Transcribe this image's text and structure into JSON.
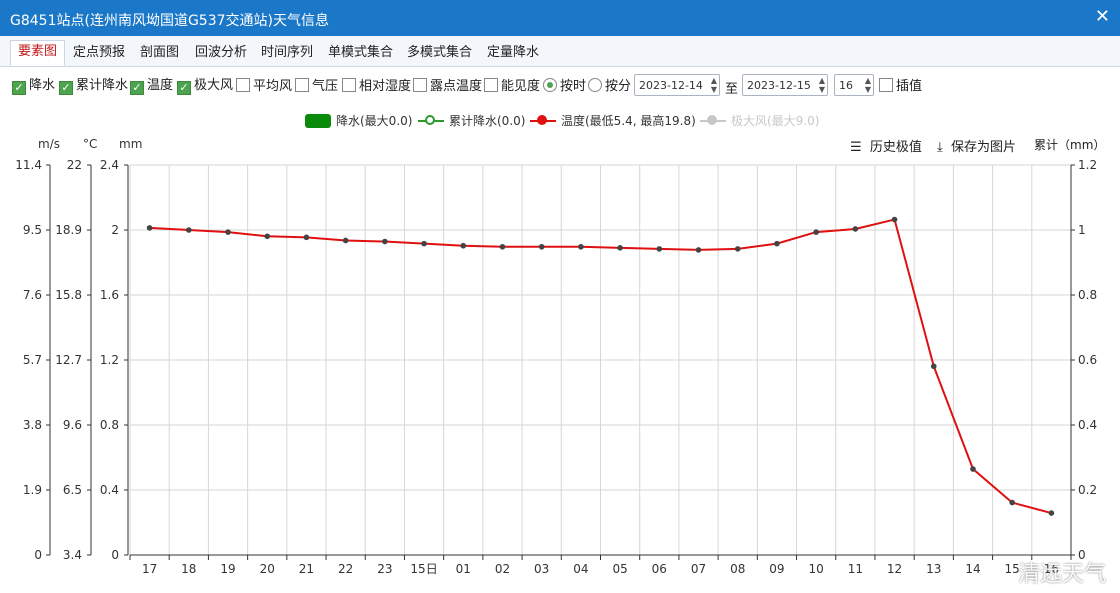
{
  "window": {
    "title": "G8451站点(连州南风坳国道G537交通站)天气信息"
  },
  "tabs": [
    "要素图",
    "定点预报",
    "剖面图",
    "回波分析",
    "时间序列",
    "单模式集合",
    "多模式集合",
    "定量降水"
  ],
  "active_tab": "要素图",
  "toolbar": {
    "checkboxes": [
      {
        "label": "降水",
        "checked": true
      },
      {
        "label": "累计降水",
        "checked": true
      },
      {
        "label": "温度",
        "checked": true
      },
      {
        "label": "极大风",
        "checked": true
      },
      {
        "label": "平均风",
        "checked": false
      },
      {
        "label": "气压",
        "checked": false
      },
      {
        "label": "相对湿度",
        "checked": false
      },
      {
        "label": "露点温度",
        "checked": false
      },
      {
        "label": "能见度",
        "checked": false
      }
    ],
    "radio_hourly": "按时",
    "radio_daily": "按分",
    "radio_selected": "按时",
    "start_date": "2023-12-14",
    "to_label": "至",
    "end_date": "2023-12-15",
    "hour_value": "16",
    "interp_label": "插值",
    "interp_checked": false
  },
  "legend": {
    "precip": "降水(最大0.0)",
    "cum_precip": "累计降水(0.0)",
    "temp": "温度(最低5.4, 最高19.8)",
    "wind": "极大风(最大9.0)"
  },
  "chart_tools": {
    "history": "历史极值",
    "save": "保存为图片",
    "right_unit": "累计（mm）"
  },
  "colors": {
    "title_bar": "#1b78c8",
    "active_tab": "#c31a1a",
    "precip": "#0a8a0a",
    "cum_precip": "#2e9a2e",
    "temp": "#e01010",
    "wind_legend": "#c8c8c8"
  },
  "watermark": "清远天气",
  "chart_data": {
    "type": "line",
    "x": [
      "17",
      "18",
      "19",
      "20",
      "21",
      "22",
      "23",
      "15日",
      "01",
      "02",
      "03",
      "04",
      "05",
      "06",
      "07",
      "08",
      "09",
      "10",
      "11",
      "12",
      "13",
      "14",
      "15",
      "16"
    ],
    "series": [
      {
        "name": "温度(最低5.4, 最高19.8)",
        "axis": "temp",
        "values": [
          19.0,
          18.9,
          18.8,
          18.6,
          18.55,
          18.4,
          18.35,
          18.25,
          18.15,
          18.1,
          18.1,
          18.1,
          18.05,
          18.0,
          17.95,
          18.0,
          18.25,
          18.8,
          18.95,
          19.4,
          12.4,
          7.5,
          5.9,
          5.4
        ]
      }
    ],
    "axes": {
      "wind": {
        "unit": "m/s",
        "ticks": [
          "0",
          "1.9",
          "3.8",
          "5.7",
          "7.6",
          "9.5",
          "11.4"
        ]
      },
      "temp": {
        "unit": "°C",
        "ticks": [
          "3.4",
          "6.5",
          "9.6",
          "12.7",
          "15.8",
          "18.9",
          "22"
        ],
        "range": [
          3.4,
          22
        ]
      },
      "precip": {
        "unit": "mm",
        "ticks": [
          "0",
          "0.4",
          "0.8",
          "1.2",
          "1.6",
          "2",
          "2.4"
        ]
      },
      "cum_precip": {
        "ticks": [
          "0",
          "0.2",
          "0.4",
          "0.6",
          "0.8",
          "1",
          "1.2"
        ]
      }
    },
    "grid": true
  }
}
